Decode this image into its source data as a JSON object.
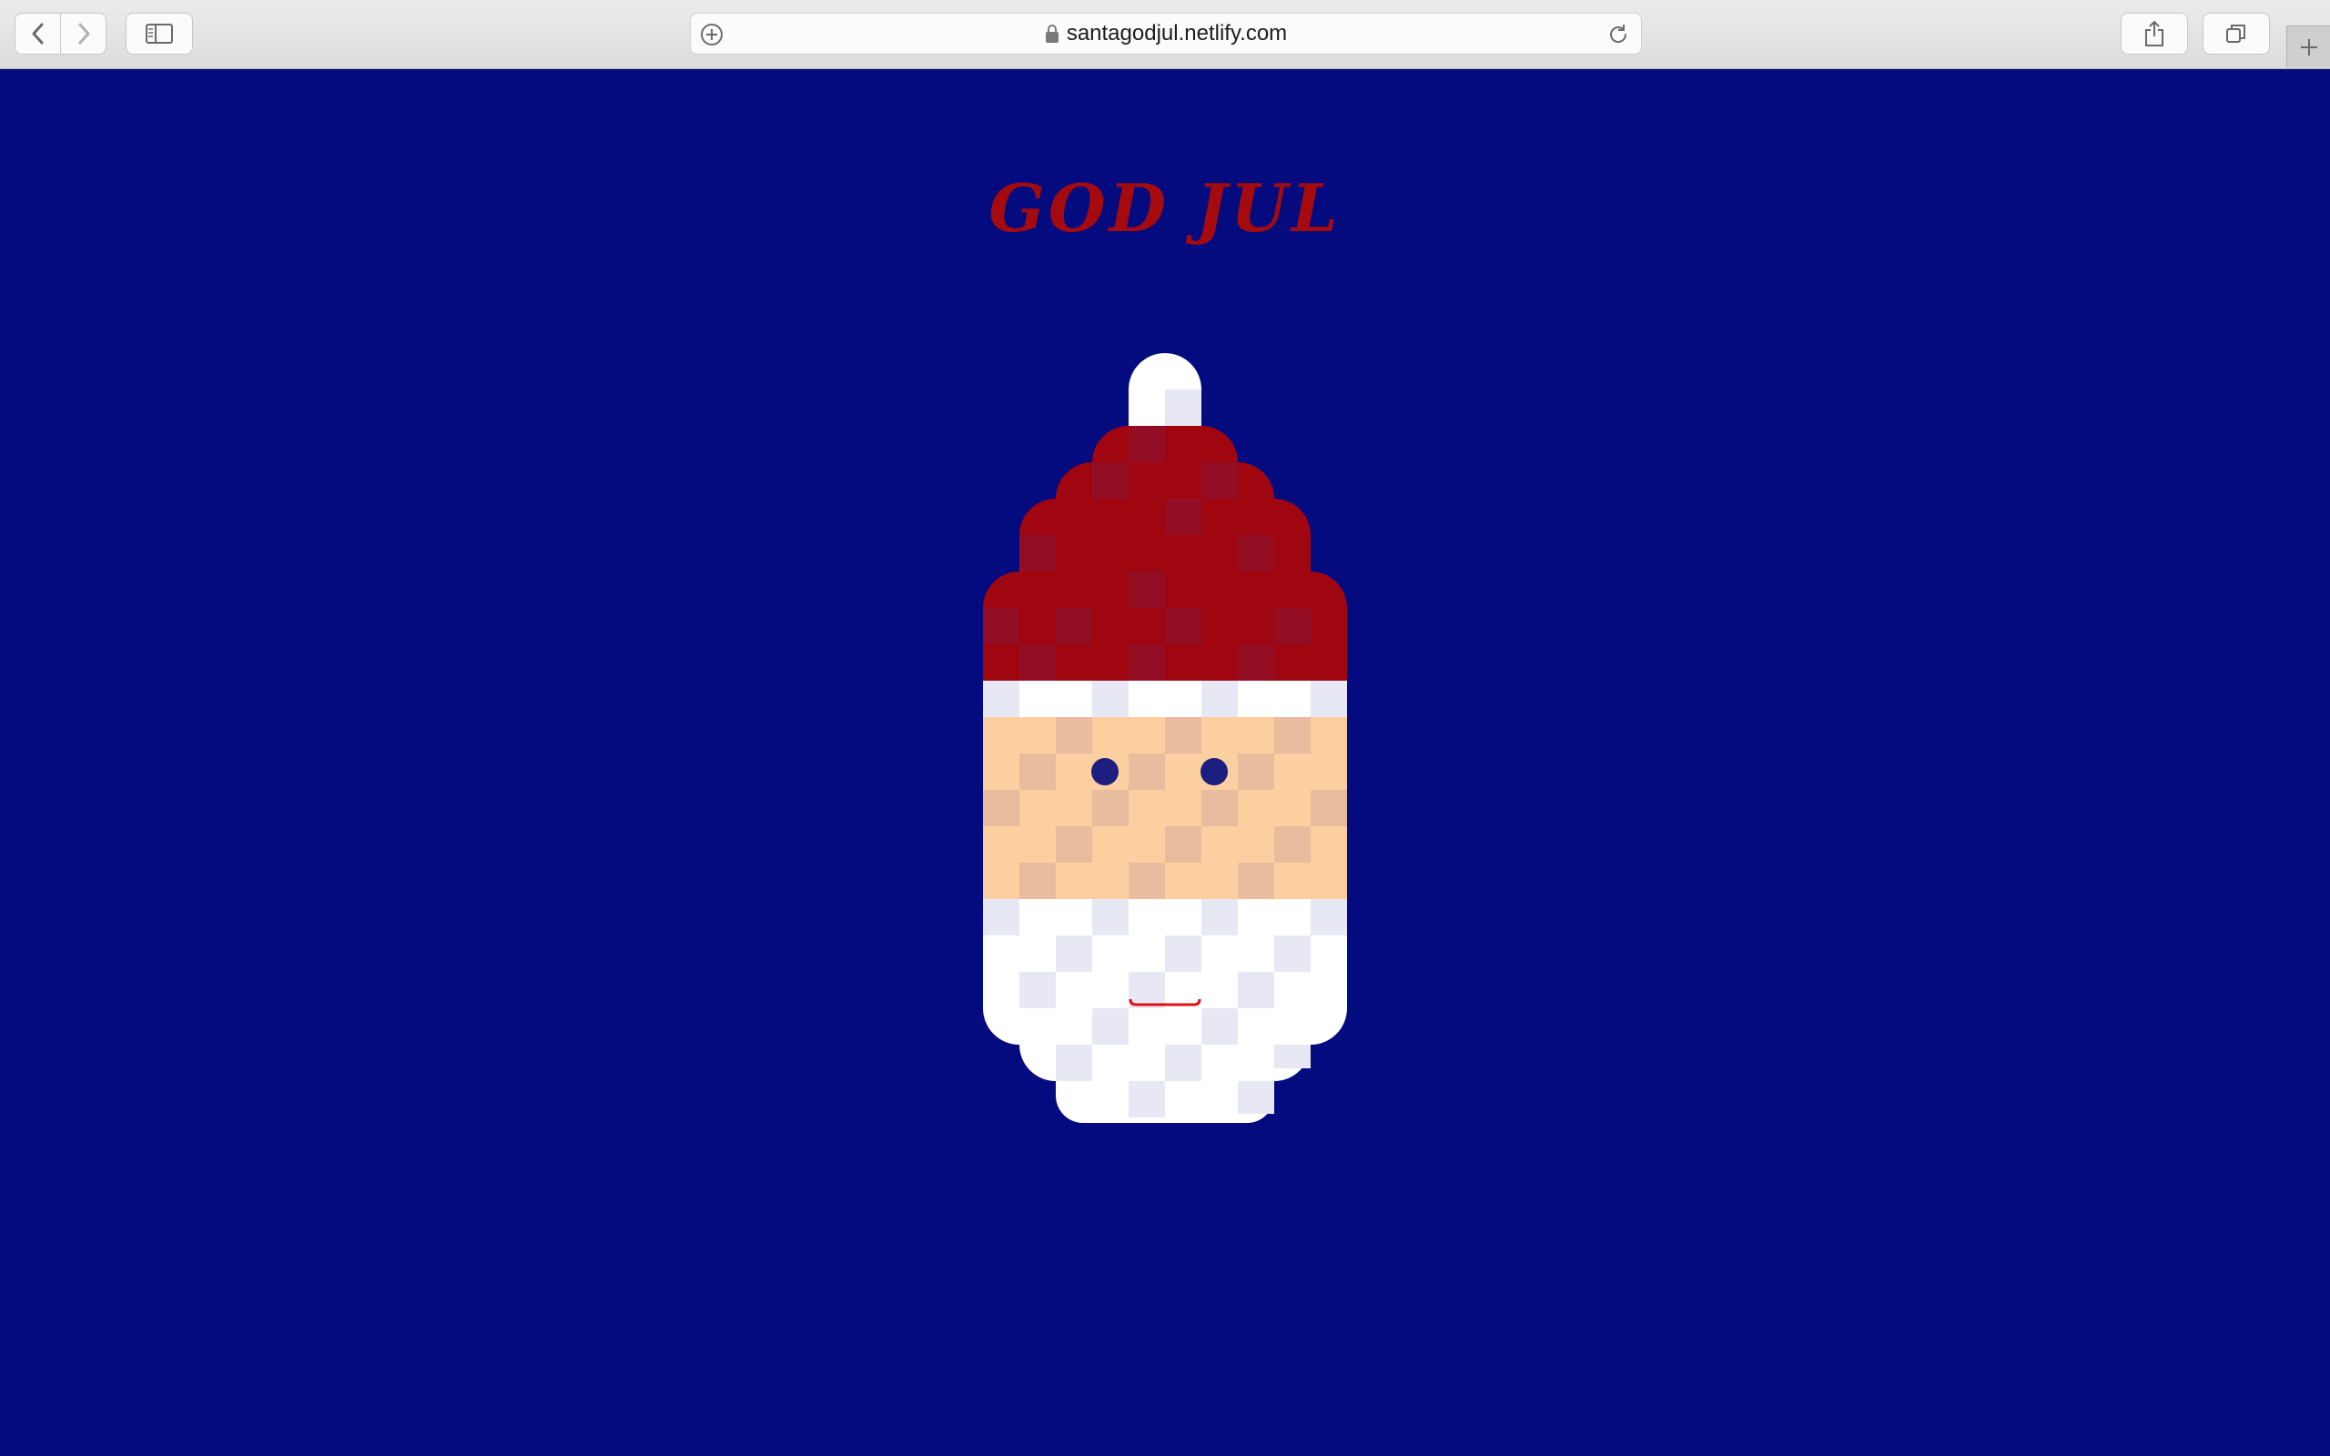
{
  "browser": {
    "url": "santagodjul.netlify.com",
    "icons": {
      "back": "chevron-left-icon",
      "forward": "chevron-right-icon",
      "sidebar": "sidebar-icon",
      "add": "plus-circle-icon",
      "lock": "lock-icon",
      "reload": "reload-icon",
      "share": "share-icon",
      "tabs": "tabs-icon",
      "new_tab": "plus-icon"
    }
  },
  "page": {
    "title": "GOD JUL",
    "colors": {
      "background": "#030b7e",
      "title": "#a50a0e",
      "hat": "#a00610",
      "hat_dark": "#930e24",
      "skin": "#fccfa0",
      "skin_dark": "#e8bc9e",
      "beard": "#ffffff",
      "beard_shade": "#e8e8f4",
      "eyes": "#1c1e80",
      "mouth": "#e01018"
    }
  }
}
